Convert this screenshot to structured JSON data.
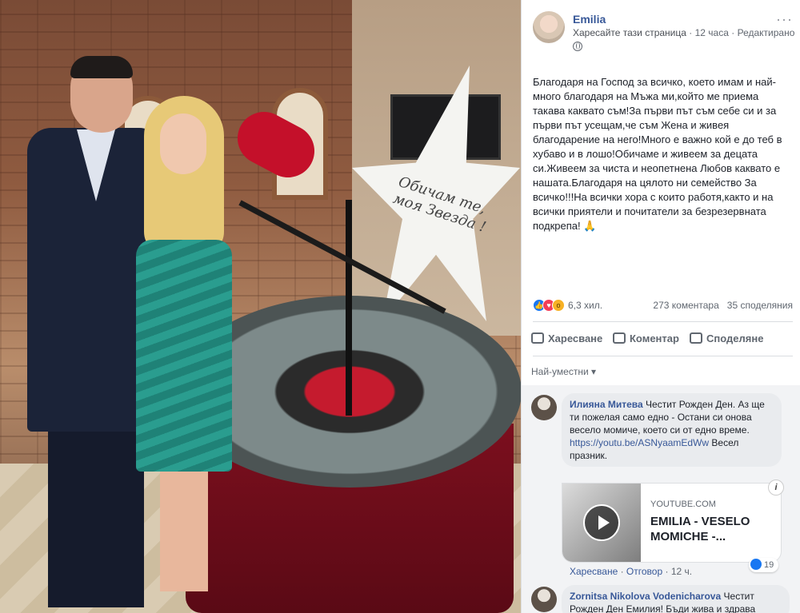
{
  "post": {
    "author": "Emilia",
    "like_page": "Харесайте тази страница",
    "separator": "·",
    "time": "12 часа",
    "edited": "Редактирано",
    "menu": "···",
    "text": "Благодаря на Господ за всичко, което имам и най-много благодаря на Мъжа ми,който ме приема такава каквато съм!За първи път съм себе си и за първи път усещам,че съм Жена и живея благодарение на него!Много е важно кой е до теб в хубаво и в лошо!Обичаме и живеем за децата си.Живеем за чиста и неопетнена Любов каквато е нашата.Благодаря на цялото ни семейство За всичко!!!На всички хора с които работя,както и на всички приятели и почитатели за безрезервната подкрепа! 🙏"
  },
  "photo": {
    "star_text": "Обичам те, моя Звезда !"
  },
  "reactions": {
    "count": "6,3 хил.",
    "comments": "273 коментара",
    "shares": "35 споделяния",
    "icons": [
      "like-icon",
      "love-icon",
      "wow-icon"
    ]
  },
  "actions": {
    "like": "Харесване",
    "comment": "Коментар",
    "share": "Споделяне"
  },
  "sort": {
    "label": "Най-уместни ▾"
  },
  "comments": [
    {
      "author": "Илияна Митева",
      "text": "Честит Рожден Ден. Аз ще ти пожелая само едно - Остани си онова весело момиче, което си от едно време.",
      "link": "https://youtu.be/ASNyaamEdWw",
      "after_link": "Весел празник.",
      "preview": {
        "source": "YOUTUBE.COM",
        "title": "EMILIA - VESELO MOMICHE -...",
        "info": "i"
      },
      "like": "Харесване",
      "reply": "Отговор",
      "time": "12 ч.",
      "reactions": "19"
    },
    {
      "author": "Zornitsa Nikolova Vodenicharova",
      "text": "Честит Рожден Ден Емилия! Бъди жива и здрава"
    }
  ],
  "colors": {
    "link": "#385898",
    "meta": "#606770",
    "like_blue": "#1877f2"
  }
}
